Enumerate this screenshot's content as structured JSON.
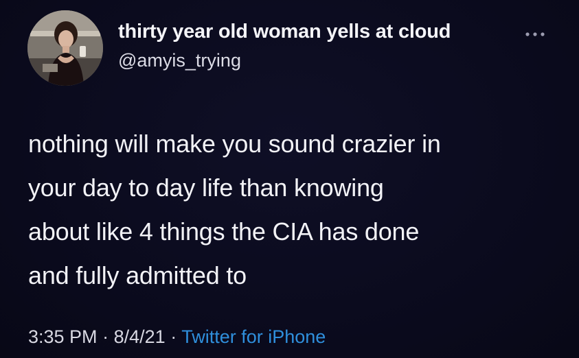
{
  "author": {
    "display_name": "thirty year old woman yells at cloud",
    "handle": "@amyis_trying",
    "avatar_icon": "profile-photo"
  },
  "menu_icon": "more-options-icon",
  "tweet": {
    "lines": [
      "nothing will make you sound crazier in",
      "your day to day life than knowing",
      "about like 4 things the CIA has done",
      "and fully admitted to"
    ]
  },
  "meta": {
    "time": "3:35 PM",
    "separator": "·",
    "date": "8/4/21",
    "source": "Twitter for iPhone"
  },
  "colors": {
    "background": "#0b0b1e",
    "text": "#f2f2f6",
    "link": "#2f8fdc"
  }
}
